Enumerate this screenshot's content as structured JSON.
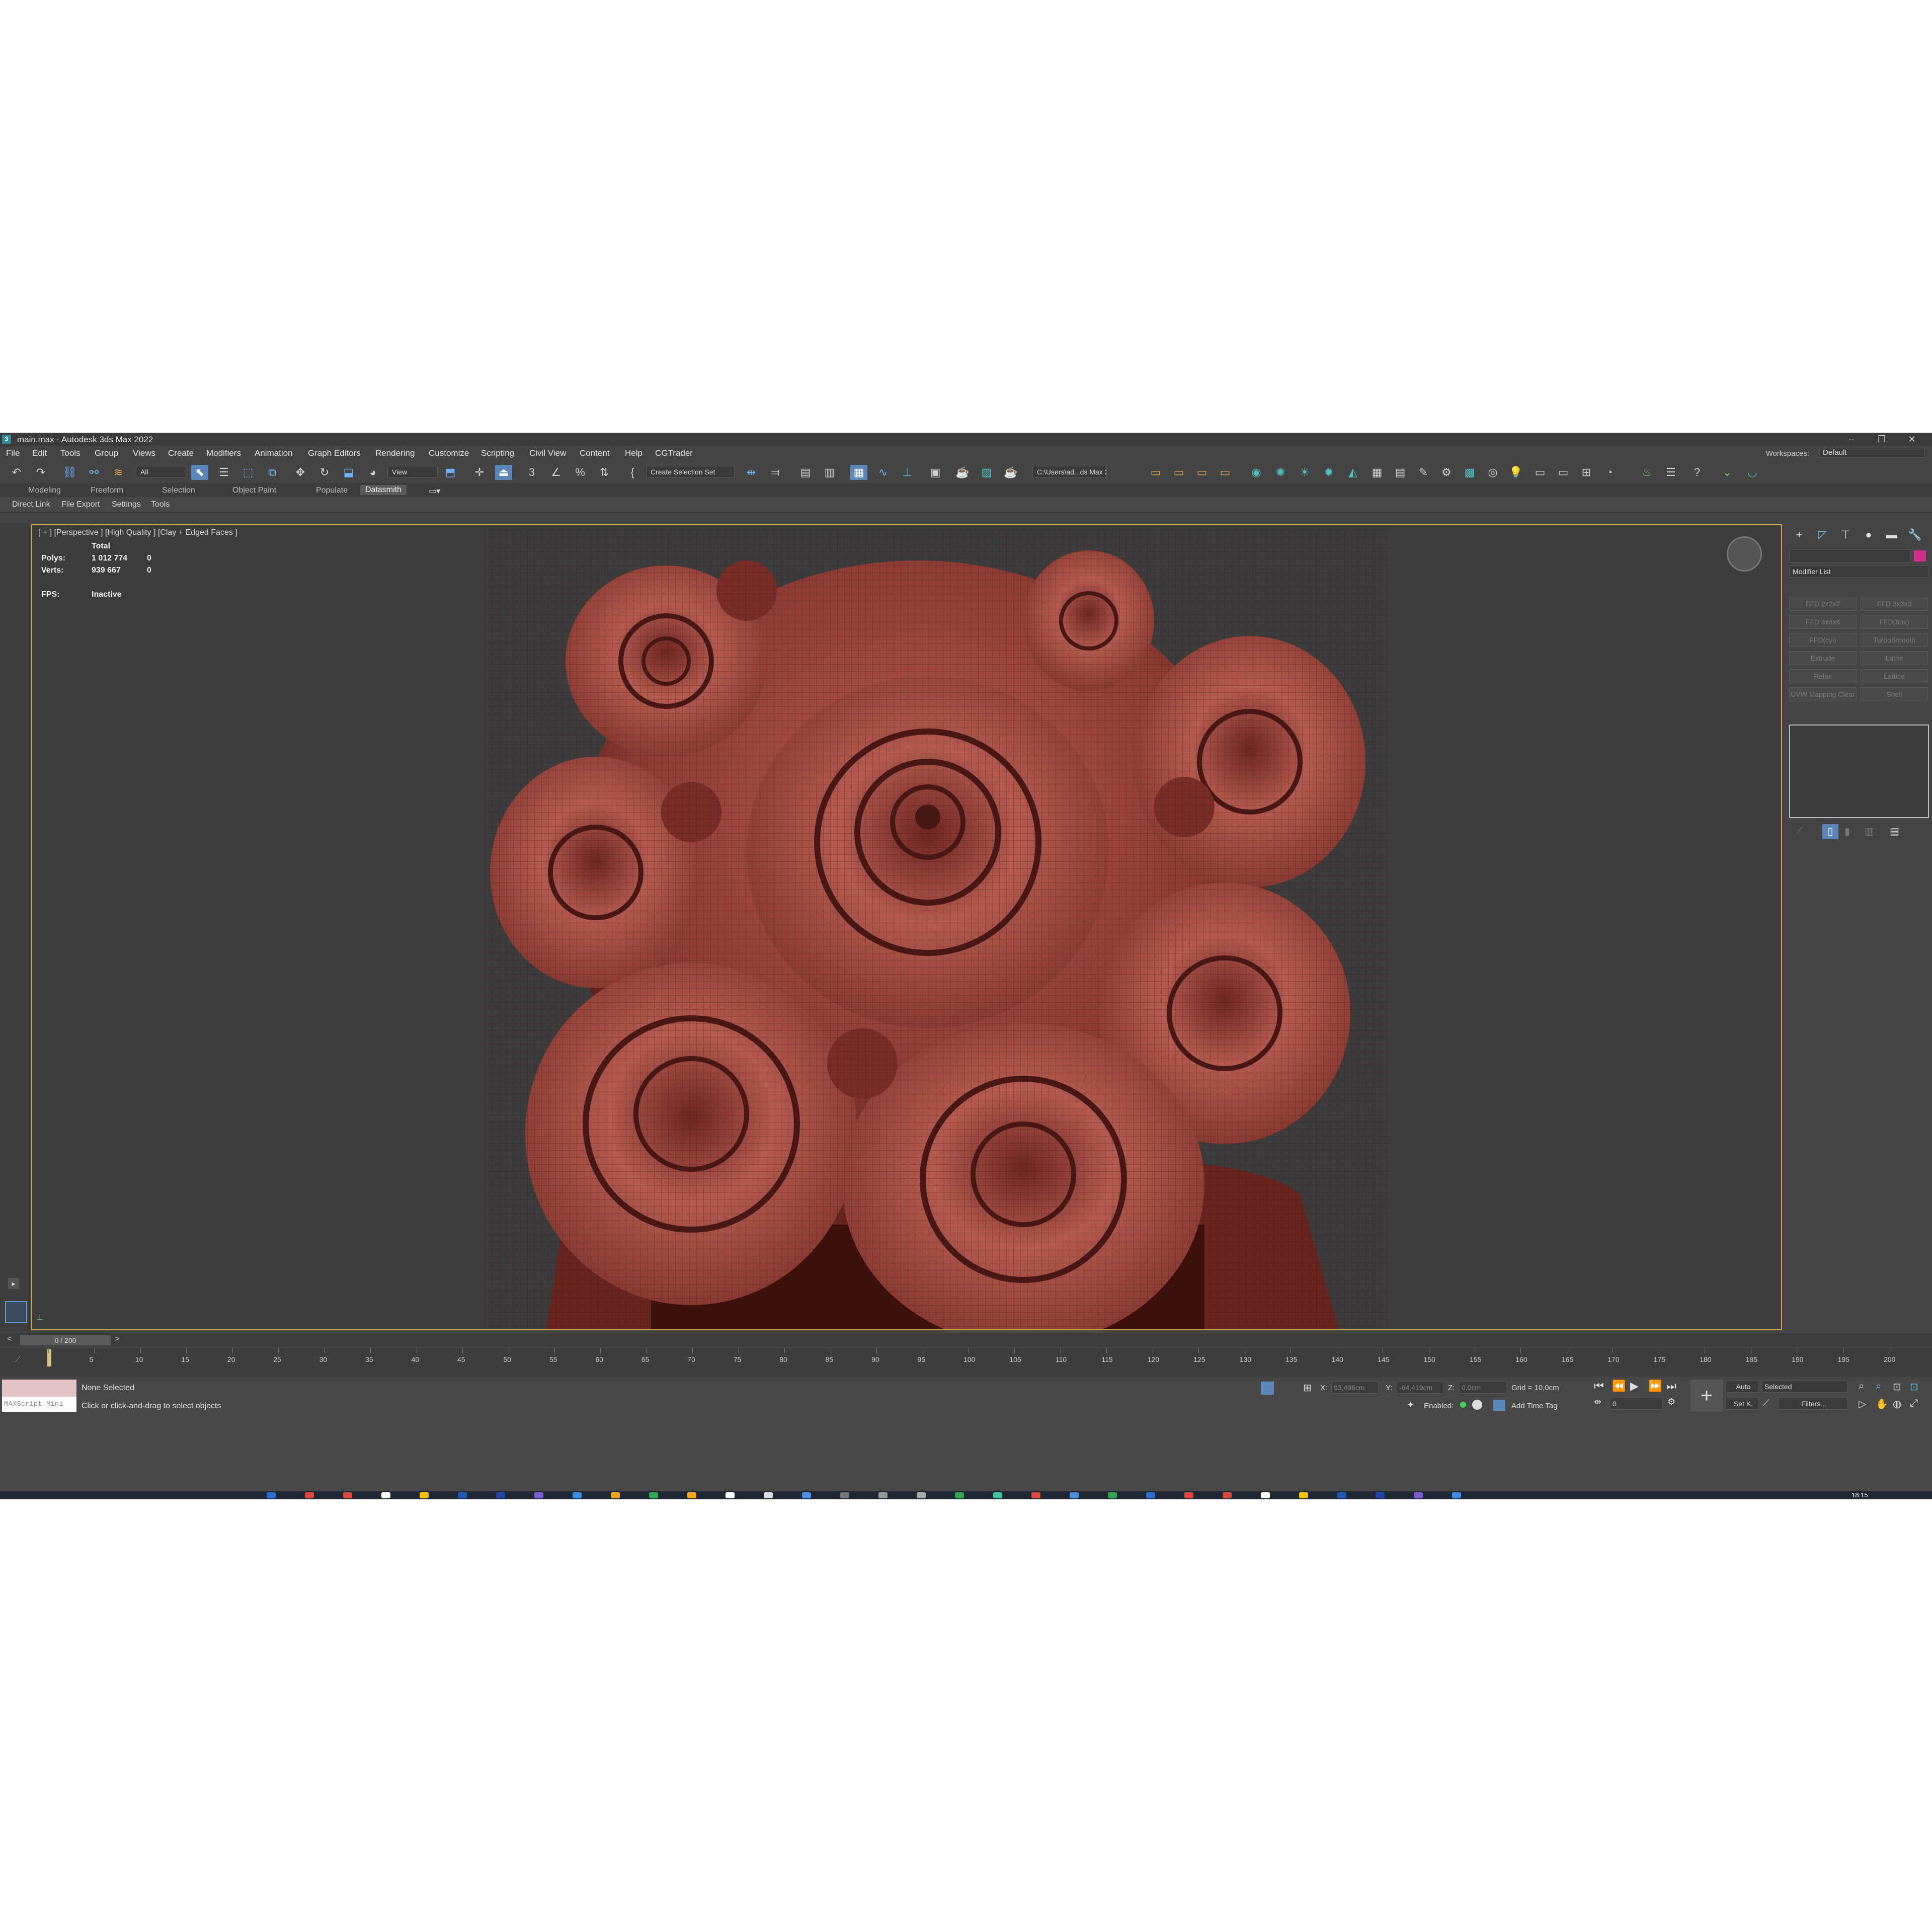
{
  "window": {
    "title": "main.max - Autodesk 3ds Max 2022",
    "min": "–",
    "max": "❐",
    "close": "✕"
  },
  "menu": [
    "File",
    "Edit",
    "Tools",
    "Group",
    "Views",
    "Create",
    "Modifiers",
    "Animation",
    "Graph Editors",
    "Rendering",
    "Customize",
    "Scripting",
    "Civil View",
    "Content",
    "Help",
    "CGTrader"
  ],
  "workspaces": {
    "label": "Workspaces:",
    "value": "Default"
  },
  "toolbar": {
    "filter": "All",
    "ref_coord": "View",
    "selection_set": "Create Selection Set",
    "project_path": "C:\\Users\\ad...ds Max 2022"
  },
  "ribbon": {
    "tabs": [
      "Modeling",
      "Freeform",
      "Selection",
      "Object Paint",
      "Populate",
      "Datasmith"
    ],
    "active_tab": "Datasmith",
    "subtabs": [
      "Direct Link",
      "File Export",
      "Settings",
      "Tools"
    ]
  },
  "viewport": {
    "label": "[ + ] [Perspective ] [High Quality ] [Clay + Edged Faces ]",
    "stats": {
      "header": "Total",
      "polys_label": "Polys:",
      "polys_value": "1 012 774",
      "polys_sel": "0",
      "verts_label": "Verts:",
      "verts_value": "939 667",
      "verts_sel": "0",
      "fps_label": "FPS:",
      "fps_value": "Inactive"
    }
  },
  "command_panel": {
    "modifier_list": "Modifier List",
    "buttons": [
      "FFD 2x2x2",
      "FFD 3x3x3",
      "FFD 4x4x4",
      "FFD(box)",
      "FFD(cyl)",
      "TurboSmooth",
      "Extrude",
      "Lathe",
      "Relax",
      "Lattice",
      "UVW Mapping Clear",
      "Shell"
    ]
  },
  "timeline": {
    "slider": "0 / 200",
    "ticks": [
      "0",
      "5",
      "10",
      "15",
      "20",
      "25",
      "30",
      "35",
      "40",
      "45",
      "50",
      "55",
      "60",
      "65",
      "70",
      "75",
      "80",
      "85",
      "90",
      "95",
      "100",
      "105",
      "110",
      "115",
      "120",
      "125",
      "130",
      "135",
      "140",
      "145",
      "150",
      "155",
      "160",
      "165",
      "170",
      "175",
      "180",
      "185",
      "190",
      "195",
      "200"
    ]
  },
  "status": {
    "maxscript": "MAXScript Mini",
    "selection": "None Selected",
    "prompt": "Click or click-and-drag to select objects",
    "x_label": "X:",
    "x_value": "93,496cm",
    "y_label": "Y:",
    "y_value": "-64,419cm",
    "z_label": "Z:",
    "z_value": "0,0cm",
    "grid": "Grid = 10,0cm",
    "enabled": "Enabled:",
    "add_time_tag": "Add Time Tag",
    "auto": "Auto",
    "set_key": "Set K.",
    "key_filter": "Selected",
    "filters": "Filters...",
    "frame": "0"
  },
  "taskbar": {
    "clock": "18:15"
  }
}
